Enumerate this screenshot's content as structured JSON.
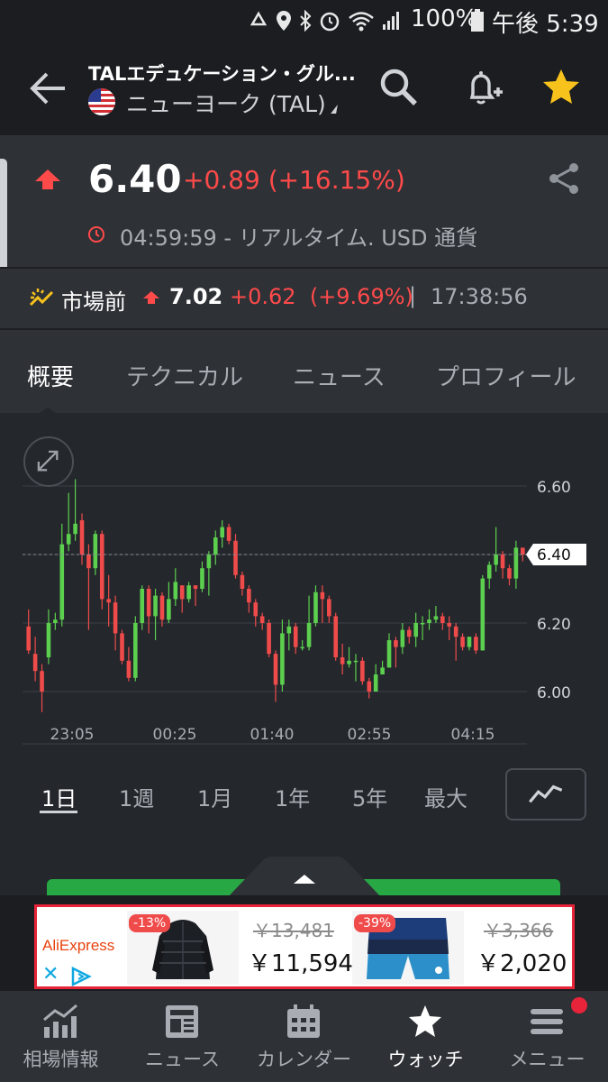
{
  "status_bar": {
    "battery": "100%",
    "time": "午後 5:39",
    "icons": [
      "recycle-icon",
      "location-icon",
      "bluetooth-icon",
      "alarm-icon",
      "wifi-icon",
      "signal-icon",
      "battery-icon"
    ]
  },
  "header": {
    "title": "TALエデュケーション・グル...",
    "exchange": "ニューヨーク (TAL)",
    "back_icon": "back-arrow-icon",
    "search_icon": "search-icon",
    "alert_icon": "add-alert-bell-icon",
    "watch_icon": "star-icon",
    "star_color": "#f7c21b"
  },
  "quote": {
    "price": "6.40",
    "change": "+0.89 (+16.15%)",
    "timestamp": "04:59:59 - リアルタイム. USD 通貨",
    "up_color": "#ff4a4a"
  },
  "premarket": {
    "label": "市場前",
    "price": "7.02",
    "change": "+0.62",
    "percent": "(+9.69%)",
    "separator": "|",
    "time": "17:38:56"
  },
  "tabs": [
    {
      "label": "概要",
      "active": true
    },
    {
      "label": "テクニカル",
      "active": false
    },
    {
      "label": "ニュース",
      "active": false
    },
    {
      "label": "プロフィール",
      "active": false
    }
  ],
  "chart_data": {
    "type": "candlestick",
    "x_ticks": [
      "23:05",
      "00:25",
      "01:40",
      "02:55",
      "04:15"
    ],
    "y_ticks": [
      6.0,
      6.2,
      6.4,
      6.6
    ],
    "y_tick_labels": [
      "6.00",
      "6.20",
      "6.40",
      "6.60"
    ],
    "ylim": [
      5.93,
      6.68
    ],
    "last_price": 6.4,
    "last_price_label": "6.40",
    "grid": true,
    "up_color": "#5ccf4f",
    "down_color": "#f04b4b",
    "candles": [
      [
        6.19,
        6.12,
        6.24,
        6.11
      ],
      [
        6.11,
        6.06,
        6.16,
        6.03
      ],
      [
        6.06,
        6.0,
        6.08,
        5.94
      ],
      [
        6.1,
        6.2,
        6.24,
        6.08
      ],
      [
        6.2,
        6.21,
        6.23,
        6.18
      ],
      [
        6.21,
        6.43,
        6.49,
        6.19
      ],
      [
        6.43,
        6.46,
        6.58,
        6.41
      ],
      [
        6.46,
        6.49,
        6.62,
        6.44
      ],
      [
        6.5,
        6.4,
        6.52,
        6.37
      ],
      [
        6.4,
        6.36,
        6.43,
        6.18
      ],
      [
        6.36,
        6.46,
        6.47,
        6.34
      ],
      [
        6.46,
        6.27,
        6.47,
        6.24
      ],
      [
        6.27,
        6.26,
        6.34,
        6.19
      ],
      [
        6.26,
        6.17,
        6.28,
        6.12
      ],
      [
        6.17,
        6.09,
        6.18,
        6.08
      ],
      [
        6.09,
        6.04,
        6.13,
        6.03
      ],
      [
        6.04,
        6.2,
        6.22,
        6.03
      ],
      [
        6.2,
        6.3,
        6.31,
        6.18
      ],
      [
        6.3,
        6.22,
        6.31,
        6.17
      ],
      [
        6.22,
        6.28,
        6.3,
        6.15
      ],
      [
        6.28,
        6.21,
        6.29,
        6.19
      ],
      [
        6.21,
        6.27,
        6.32,
        6.2
      ],
      [
        6.27,
        6.32,
        6.36,
        6.25
      ],
      [
        6.31,
        6.27,
        6.31,
        6.23
      ],
      [
        6.27,
        6.31,
        6.32,
        6.26
      ],
      [
        6.31,
        6.3,
        6.31,
        6.25
      ],
      [
        6.3,
        6.36,
        6.38,
        6.29
      ],
      [
        6.36,
        6.4,
        6.41,
        6.28
      ],
      [
        6.4,
        6.45,
        6.47,
        6.37
      ],
      [
        6.45,
        6.48,
        6.5,
        6.42
      ],
      [
        6.48,
        6.44,
        6.49,
        6.43
      ],
      [
        6.44,
        6.34,
        6.46,
        6.33
      ],
      [
        6.34,
        6.3,
        6.35,
        6.28
      ],
      [
        6.3,
        6.26,
        6.31,
        6.23
      ],
      [
        6.26,
        6.22,
        6.27,
        6.19
      ],
      [
        6.22,
        6.2,
        6.23,
        6.18
      ],
      [
        6.2,
        6.11,
        6.21,
        6.1
      ],
      [
        6.11,
        6.02,
        6.12,
        5.97
      ],
      [
        6.02,
        6.17,
        6.21,
        6.0
      ],
      [
        6.17,
        6.19,
        6.21,
        6.12
      ],
      [
        6.19,
        6.13,
        6.2,
        6.11
      ],
      [
        6.13,
        6.13,
        6.15,
        6.12
      ],
      [
        6.13,
        6.2,
        6.28,
        6.12
      ],
      [
        6.2,
        6.29,
        6.31,
        6.19
      ],
      [
        6.29,
        6.27,
        6.31,
        6.2
      ],
      [
        6.27,
        6.22,
        6.28,
        6.2
      ],
      [
        6.22,
        6.1,
        6.23,
        6.09
      ],
      [
        6.1,
        6.08,
        6.14,
        6.05
      ],
      [
        6.08,
        6.09,
        6.13,
        6.07
      ],
      [
        6.09,
        6.09,
        6.11,
        6.03
      ],
      [
        6.09,
        6.03,
        6.1,
        6.02
      ],
      [
        6.03,
        6.0,
        6.04,
        5.98
      ],
      [
        6.0,
        6.05,
        6.08,
        6.0
      ],
      [
        6.05,
        6.07,
        6.09,
        6.05
      ],
      [
        6.07,
        6.15,
        6.17,
        6.07
      ],
      [
        6.15,
        6.13,
        6.16,
        6.07
      ],
      [
        6.13,
        6.18,
        6.2,
        6.11
      ],
      [
        6.18,
        6.16,
        6.19,
        6.14
      ],
      [
        6.16,
        6.2,
        6.23,
        6.13
      ],
      [
        6.2,
        6.2,
        6.22,
        6.15
      ],
      [
        6.2,
        6.21,
        6.24,
        6.18
      ],
      [
        6.21,
        6.22,
        6.25,
        6.2
      ],
      [
        6.22,
        6.2,
        6.23,
        6.18
      ],
      [
        6.2,
        6.19,
        6.22,
        6.15
      ],
      [
        6.19,
        6.16,
        6.2,
        6.09
      ],
      [
        6.16,
        6.13,
        6.17,
        6.12
      ],
      [
        6.13,
        6.16,
        6.16,
        6.12
      ],
      [
        6.16,
        6.12,
        6.17,
        6.11
      ],
      [
        6.12,
        6.33,
        6.34,
        6.12
      ],
      [
        6.33,
        6.37,
        6.38,
        6.3
      ],
      [
        6.37,
        6.4,
        6.48,
        6.35
      ],
      [
        6.4,
        6.36,
        6.41,
        6.33
      ],
      [
        6.36,
        6.33,
        6.37,
        6.31
      ],
      [
        6.33,
        6.42,
        6.44,
        6.3
      ],
      [
        6.42,
        6.4,
        6.42,
        6.38
      ]
    ]
  },
  "time_ranges": [
    {
      "label": "1日",
      "active": true
    },
    {
      "label": "1週",
      "active": false
    },
    {
      "label": "1月",
      "active": false
    },
    {
      "label": "1年",
      "active": false
    },
    {
      "label": "5年",
      "active": false
    },
    {
      "label": "最大",
      "active": false
    }
  ],
  "ad": {
    "brand": "AliExpress",
    "close": "✕",
    "items": [
      {
        "discount": "-13%",
        "old_price": "￥13,481",
        "price": "￥11,594",
        "image": "black-puffer-jacket"
      },
      {
        "discount": "-39%",
        "old_price": "￥3,366",
        "price": "￥2,020",
        "image": "blue-board-shorts"
      }
    ]
  },
  "bottom_nav": [
    {
      "label": "相場情報",
      "icon": "markets-chart-icon",
      "active": false
    },
    {
      "label": "ニュース",
      "icon": "news-icon",
      "active": false
    },
    {
      "label": "カレンダー",
      "icon": "calendar-icon",
      "active": false
    },
    {
      "label": "ウォッチ",
      "icon": "star-icon",
      "active": true
    },
    {
      "label": "メニュー",
      "icon": "menu-icon",
      "active": false,
      "badge": true
    }
  ]
}
